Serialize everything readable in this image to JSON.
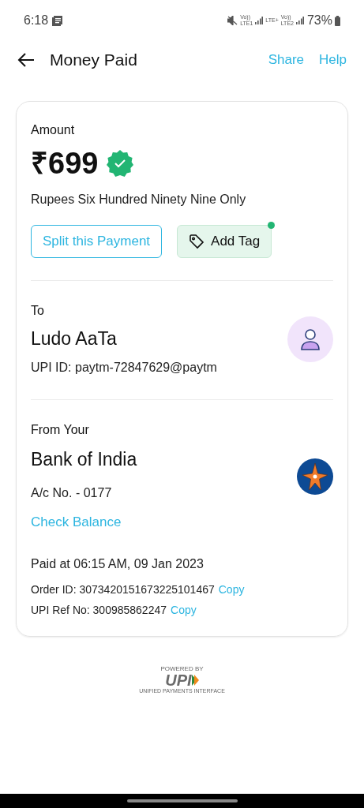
{
  "status_bar": {
    "time": "6:18",
    "sim_labels": [
      {
        "top": "Vo))",
        "bottom": "LTE1"
      },
      {
        "top": "LTE+"
      },
      {
        "top": "Vo))",
        "bottom": "LTE2"
      }
    ],
    "battery": "73%"
  },
  "header": {
    "title": "Money Paid",
    "actions": [
      "Share",
      "Help"
    ]
  },
  "amount": {
    "label": "Amount",
    "value": "₹699",
    "verified": true,
    "in_words": "Rupees Six Hundred Ninety Nine Only"
  },
  "buttons": [
    {
      "kind": "outline",
      "label": "Split this Payment",
      "notification_dot": false
    },
    {
      "kind": "tag",
      "label": "Add Tag",
      "notification_dot": true
    }
  ],
  "to": {
    "label": "To",
    "name": "Ludo AaTa",
    "upi_id": "UPI ID: paytm-72847629@paytm"
  },
  "from": {
    "label": "From Your",
    "bank": "Bank of India",
    "account": "A/c No. - 0177",
    "link": "Check Balance"
  },
  "paid_at": "Paid at 06:15 AM, 09 Jan 2023",
  "ids": [
    {
      "text": "Order ID: 3073420151673225101467",
      "action": "Copy"
    },
    {
      "text": "UPI Ref No: 300985862247",
      "action": "Copy"
    }
  ],
  "footer": {
    "powered_by": "POWERED BY",
    "logo": "UPI",
    "tagline": "UNIFIED PAYMENTS INTERFACE"
  }
}
